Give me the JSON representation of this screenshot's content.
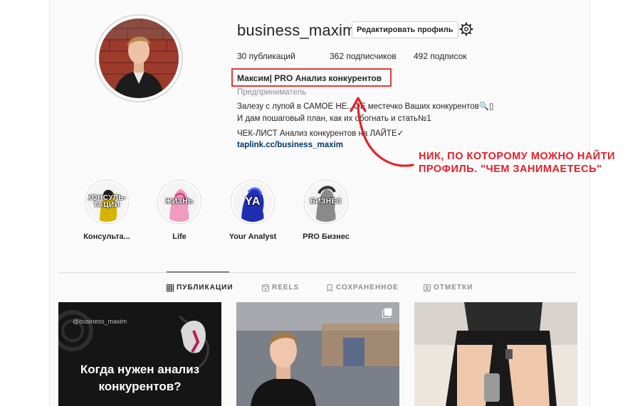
{
  "profile": {
    "username": "business_maxim",
    "edit_button": "Редактировать профиль",
    "settings_icon": "gear-icon",
    "stats": {
      "posts": "30 публикаций",
      "followers": "362 подписчиков",
      "following": "492 подписок"
    },
    "full_name": "Максим| PRO Анализ конкурентов",
    "category": "Предприниматель",
    "bio": [
      "Залезу с лупой в САМОЕ НЕ...ОЕ местечко Ваших конкурентов🔍▯",
      "И дам пошаговый план, как их обогнать и стать№1",
      "ЧЕК-ЛИСТ Анализ конкурентов на ЛАЙТЕ✓"
    ],
    "link": "taplink.cc/business_maxim"
  },
  "annotation": {
    "line1": "НИК, ПО КОТОРОМУ МОЖНО НАЙТИ",
    "line2": "ПРОФИЛЬ. \"ЧЕМ ЗАНИМАЕТЕСЬ\"",
    "color": "#e3202a"
  },
  "highlights": [
    {
      "cover_text": "КОНСУЛЬ-ТАЦИИ",
      "label": "Консульта...",
      "color": "#d8b400"
    },
    {
      "cover_text": "ЖИЗНЬ",
      "label": "Life",
      "color": "#e86aa0"
    },
    {
      "cover_text": "YA",
      "label": "Your Analyst",
      "color": "#2233aa"
    },
    {
      "cover_text": "БИЗНЕС",
      "label": "PRO Бизнес",
      "color": "#444444"
    }
  ],
  "tabs": [
    {
      "label": "ПУБЛИКАЦИИ",
      "icon": "grid-icon",
      "active": true
    },
    {
      "label": "REELS",
      "icon": "reels-icon",
      "active": false
    },
    {
      "label": "СОХРАНЕННОЕ",
      "icon": "bookmark-icon",
      "active": false
    },
    {
      "label": "ОТМЕТКИ",
      "icon": "tag-user-icon",
      "active": false
    }
  ],
  "posts": [
    {
      "handle": "@business_maxim",
      "title": "Когда нужен анализ конкурентов?"
    },
    {
      "type": "photo",
      "multi": true
    },
    {
      "type": "photo"
    }
  ]
}
